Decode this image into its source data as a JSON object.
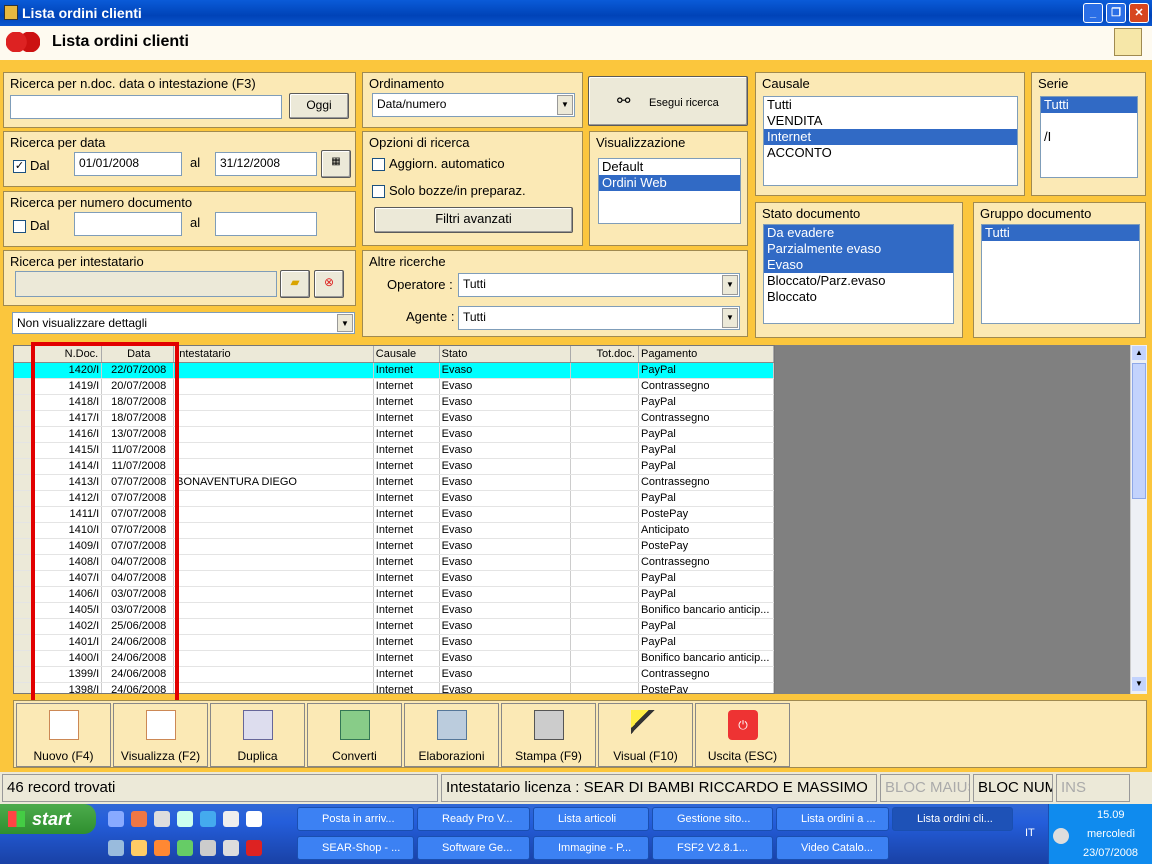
{
  "window": {
    "title": "Lista ordini clienti",
    "header_title": "Lista ordini clienti"
  },
  "search": {
    "quick_label": "Ricerca per n.doc. data o intestazione (F3)",
    "quick_value": "",
    "today_button": "Oggi",
    "date_label": "Ricerca per data",
    "date_dal_label": "Dal",
    "date_dal_checked": "✓",
    "date_from": "01/01/2008",
    "date_al_label": "al",
    "date_to": "31/12/2008",
    "num_label": "Ricerca per numero documento",
    "num_dal_label": "Dal",
    "num_from": "",
    "num_al_label": "al",
    "num_to": "",
    "owner_label": "Ricerca per intestatario",
    "owner_value": "",
    "details_value": "Non visualizzare dettagli"
  },
  "ordering": {
    "label": "Ordinamento",
    "value": "Data/numero"
  },
  "execute_button": "Esegui ricerca",
  "options": {
    "label": "Opzioni di ricerca",
    "auto_update": "Aggiorn. automatico",
    "drafts_only": "Solo bozze/in preparaz.",
    "advanced_filters": "Filtri avanzati"
  },
  "view": {
    "label": "Visualizzazione",
    "items": [
      "Default",
      "Ordini Web"
    ]
  },
  "other": {
    "label": "Altre ricerche",
    "operator_label": "Operatore :",
    "operator_value": "Tutti",
    "agent_label": "Agente :",
    "agent_value": "Tutti"
  },
  "causale": {
    "label": "Causale",
    "items": [
      "Tutti",
      "VENDITA",
      "Internet",
      "ACCONTO"
    ]
  },
  "serie": {
    "label": "Serie",
    "items": [
      "Tutti",
      "",
      "/I"
    ]
  },
  "stato": {
    "label": "Stato documento",
    "items": [
      "Da evadere",
      "Parzialmente evaso",
      "Evaso",
      "Bloccato/Parz.evaso",
      "Bloccato"
    ]
  },
  "gruppo": {
    "label": "Gruppo documento",
    "items": [
      "Tutti"
    ]
  },
  "grid": {
    "columns": [
      "N.Doc.",
      "Data",
      "Intestatario",
      "Causale",
      "Stato",
      "Tot.doc.",
      "Pagamento"
    ],
    "rows": [
      [
        "1420/I",
        "22/07/2008",
        "",
        "Internet",
        "Evaso",
        "",
        "PayPal"
      ],
      [
        "1419/I",
        "20/07/2008",
        "",
        "Internet",
        "Evaso",
        "",
        "Contrassegno"
      ],
      [
        "1418/I",
        "18/07/2008",
        "",
        "Internet",
        "Evaso",
        "",
        "PayPal"
      ],
      [
        "1417/I",
        "18/07/2008",
        "",
        "Internet",
        "Evaso",
        "",
        "Contrassegno"
      ],
      [
        "1416/I",
        "13/07/2008",
        "",
        "Internet",
        "Evaso",
        "",
        "PayPal"
      ],
      [
        "1415/I",
        "11/07/2008",
        "",
        "Internet",
        "Evaso",
        "",
        "PayPal"
      ],
      [
        "1414/I",
        "11/07/2008",
        "",
        "Internet",
        "Evaso",
        "",
        "PayPal"
      ],
      [
        "1413/I",
        "07/07/2008",
        "BONAVENTURA DIEGO",
        "Internet",
        "Evaso",
        "",
        "Contrassegno"
      ],
      [
        "1412/I",
        "07/07/2008",
        "",
        "Internet",
        "Evaso",
        "",
        "PayPal"
      ],
      [
        "1411/I",
        "07/07/2008",
        "",
        "Internet",
        "Evaso",
        "",
        "PostePay"
      ],
      [
        "1410/I",
        "07/07/2008",
        "",
        "Internet",
        "Evaso",
        "",
        "Anticipato"
      ],
      [
        "1409/I",
        "07/07/2008",
        "",
        "Internet",
        "Evaso",
        "",
        "PostePay"
      ],
      [
        "1408/I",
        "04/07/2008",
        "",
        "Internet",
        "Evaso",
        "",
        "Contrassegno"
      ],
      [
        "1407/I",
        "04/07/2008",
        "",
        "Internet",
        "Evaso",
        "",
        "PayPal"
      ],
      [
        "1406/I",
        "03/07/2008",
        "",
        "Internet",
        "Evaso",
        "",
        "PayPal"
      ],
      [
        "1405/I",
        "03/07/2008",
        "",
        "Internet",
        "Evaso",
        "",
        "Bonifico bancario anticip..."
      ],
      [
        "1402/I",
        "25/06/2008",
        "",
        "Internet",
        "Evaso",
        "",
        "PayPal"
      ],
      [
        "1401/I",
        "24/06/2008",
        "",
        "Internet",
        "Evaso",
        "",
        "PayPal"
      ],
      [
        "1400/I",
        "24/06/2008",
        "",
        "Internet",
        "Evaso",
        "",
        "Bonifico bancario anticip..."
      ],
      [
        "1399/I",
        "24/06/2008",
        "",
        "Internet",
        "Evaso",
        "",
        "Contrassegno"
      ],
      [
        "1398/I",
        "24/06/2008",
        "",
        "Internet",
        "Evaso",
        "",
        "PostePay"
      ]
    ]
  },
  "toolbar": [
    "Nuovo (F4)",
    "Visualizza (F2)",
    "Duplica",
    "Converti",
    "Elaborazioni",
    "Stampa (F9)",
    "Visual (F10)",
    "Uscita (ESC)"
  ],
  "status": {
    "records": "46 record trovati",
    "license": "Intestatario licenza : SEAR DI BAMBI RICCARDO E MASSIMO",
    "caps": "BLOC MAIUS",
    "num": "BLOC NUM",
    "ins": "INS"
  },
  "taskbar": {
    "start": "start",
    "row1": [
      "Posta in arriv...",
      "Ready Pro V...",
      "Lista articoli",
      "Gestione sito...",
      "Lista ordini a ...",
      "Lista ordini cli..."
    ],
    "row2": [
      "SEAR-Shop - ...",
      "Software Ge...",
      "Immagine - P...",
      "FSF2 V2.8.1...",
      "Video Catalo..."
    ],
    "lang": "IT",
    "time": "15.09",
    "day": "mercoledì",
    "date": "23/07/2008"
  },
  "colors": {
    "accent": "#fbc63d",
    "selection": "#316ac5",
    "highlight_row": "#00ffff",
    "red_box": "#e20000"
  }
}
